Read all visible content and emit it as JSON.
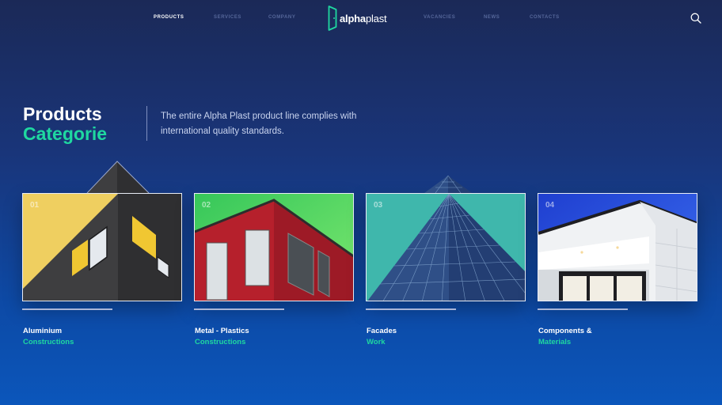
{
  "nav": {
    "left": [
      "PRODUCTS",
      "SERVICES",
      "COMPANY"
    ],
    "right": [
      "VACANCIES",
      "NEWS",
      "CONTACTS"
    ],
    "active": "PRODUCTS",
    "logo_bold": "alpha",
    "logo_light": "plast",
    "search_icon": "search-icon"
  },
  "hero": {
    "title_line1": "Products",
    "title_line2": "Categorie",
    "description": "The entire Alpha Plast product line complies with international quality standards."
  },
  "cards": [
    {
      "number": "01",
      "title": "Aluminium",
      "subtitle": "Constructions"
    },
    {
      "number": "02",
      "title": "Metal - Plastics",
      "subtitle": "Constructions"
    },
    {
      "number": "03",
      "title": "Facades",
      "subtitle": "Work"
    },
    {
      "number": "04",
      "title": "Components &",
      "subtitle": "Materials"
    }
  ],
  "colors": {
    "accent": "#1fd8a0",
    "background_top": "#1b2957",
    "background_bottom": "#0b56bb",
    "nav_inactive": "#56679a"
  }
}
